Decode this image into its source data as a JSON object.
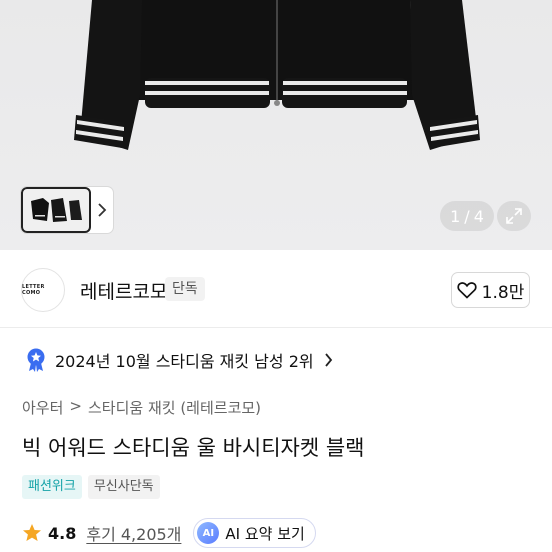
{
  "gallery": {
    "page_current": "1",
    "page_separator": "/",
    "page_total": "4"
  },
  "brand": {
    "logo_text": "LETTER COMO",
    "name": "레테르코모",
    "tag": "단독",
    "likes": "1.8만"
  },
  "ranking": {
    "text": "2024년 10월 스타디움 재킷 남성 2위"
  },
  "breadcrumb": {
    "level1": "아우터",
    "separator": ">",
    "level2": "스타디움 재킷 (레테르코모)"
  },
  "product": {
    "title": "빅 어워드 스타디움 울 바시티자켓 블랙"
  },
  "badges": {
    "first": "패션위크",
    "second": "무신사단독"
  },
  "rating": {
    "score": "4.8",
    "reviews": "후기 4,205개",
    "ai_label": "AI",
    "ai_summary": "AI 요약 보기"
  },
  "colors": {
    "accent_teal": "#16a3a8",
    "star": "#f5a623",
    "rank_badge": "#3a6df0"
  }
}
